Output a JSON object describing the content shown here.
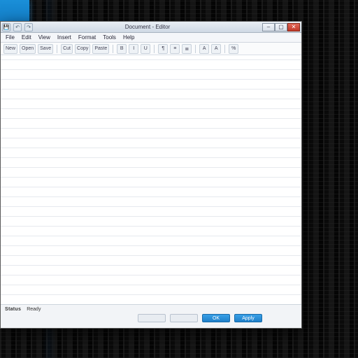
{
  "titlebar": {
    "title": "Document - Editor",
    "qat_icons": [
      "save-icon",
      "undo-icon",
      "redo-icon"
    ]
  },
  "window_controls": {
    "minimize": "–",
    "maximize": "▢",
    "close": "✕"
  },
  "menu": {
    "items": [
      "File",
      "Edit",
      "View",
      "Insert",
      "Format",
      "Tools",
      "Help"
    ]
  },
  "toolbar": {
    "groups": [
      [
        "New",
        "Open",
        "Save"
      ],
      [
        "Cut",
        "Copy",
        "Paste"
      ],
      [
        "B",
        "I",
        "U"
      ],
      [
        "¶",
        "≡",
        "≣"
      ],
      [
        "A",
        "A"
      ],
      [
        "%"
      ]
    ]
  },
  "status": {
    "label_left": "Status",
    "label_secondary": "Ready",
    "buttons": {
      "neutral1": " ",
      "neutral2": " ",
      "primary1": "OK",
      "primary2": "Apply"
    }
  },
  "colors": {
    "accent": "#1f7fc8",
    "titlebar_top": "#e8eef4",
    "close_btn": "#c13828"
  }
}
